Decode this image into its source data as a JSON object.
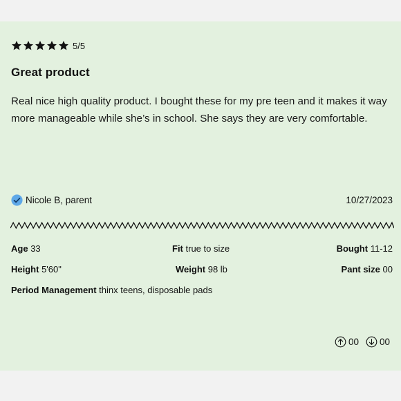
{
  "review": {
    "rating_value": 5,
    "rating_text": "5/5",
    "title": "Great product",
    "body": "Real nice high quality product. I bought these for my pre teen and it makes it way more manageable while she’s in school. She says they are very comfortable.",
    "reviewer": "Nicole B, parent",
    "verified_icon": "check-circle-icon",
    "date": "10/27/2023"
  },
  "attributes": {
    "age_label": "Age",
    "age_value": "33",
    "fit_label": "Fit",
    "fit_value": "true to size",
    "bought_label": "Bought",
    "bought_value": "11-12",
    "height_label": "Height",
    "height_value": "5'60\"",
    "weight_label": "Weight",
    "weight_value": "98 lb",
    "pant_label": "Pant size",
    "pant_value": "00",
    "period_label": "Period Management",
    "period_value": "thinx teens, disposable pads"
  },
  "votes": {
    "up_count": "00",
    "down_count": "00",
    "up_icon": "arrow-up-circle-icon",
    "down_icon": "arrow-down-circle-icon"
  },
  "colors": {
    "card_background": "#e3f1df",
    "page_background": "#f2f2f2",
    "verified_blue": "#5ea8e8",
    "text": "#111111"
  }
}
